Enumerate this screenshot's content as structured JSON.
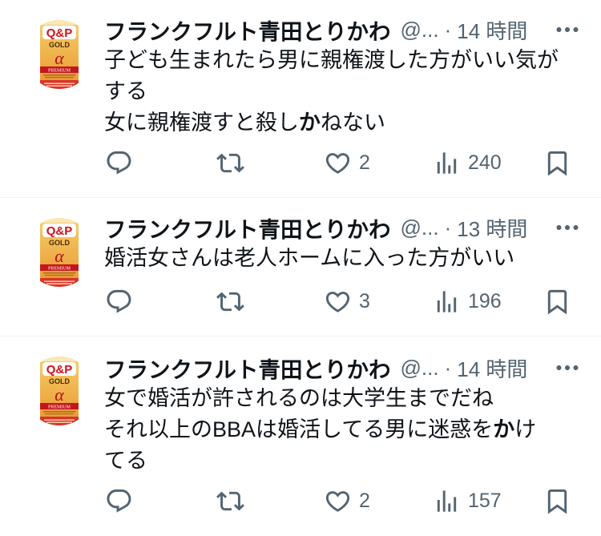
{
  "separator": "·",
  "avatar": {
    "logo_top": "Q&P",
    "logo_mid": "GOLD",
    "logo_symbol": "α",
    "logo_band": "PREMIUM"
  },
  "tweets": [
    {
      "name": "フランクフルト青田とりかわ",
      "handle": "@...",
      "time": "14 時間",
      "lines": [
        {
          "pre": "子ども生まれたら男に親権渡した方がいい気が"
        },
        {
          "pre": "する"
        },
        {
          "pre": "女に親権渡すと殺し",
          "hl": "か",
          "post": "ねない"
        }
      ],
      "likes": "2",
      "views": "240"
    },
    {
      "name": "フランクフルト青田とりかわ",
      "handle": "@...",
      "time": "13 時間",
      "lines": [
        {
          "pre": "婚活女さんは老人ホームに入った方がいい"
        }
      ],
      "likes": "3",
      "views": "196"
    },
    {
      "name": "フランクフルト青田とりかわ",
      "handle": "@...",
      "time": "14 時間",
      "lines": [
        {
          "pre": "女で婚活が許されるのは大学生までだね"
        },
        {
          "pre": "それ以上のBBAは婚活してる男に迷惑を",
          "hl": "か",
          "post": "け"
        },
        {
          "pre": "てる"
        }
      ],
      "likes": "2",
      "views": "157"
    }
  ],
  "icons": {
    "reply": "reply-icon",
    "retweet": "retweet-icon",
    "like": "heart-icon",
    "views": "views-icon",
    "bookmark": "bookmark-icon",
    "more": "more-icon"
  },
  "colors": {
    "text": "#0f1419",
    "secondary": "#536471",
    "divider": "#eff3f4",
    "background": "#ffffff",
    "avatar_gold": "#efb04b",
    "avatar_red": "#c4161c"
  }
}
